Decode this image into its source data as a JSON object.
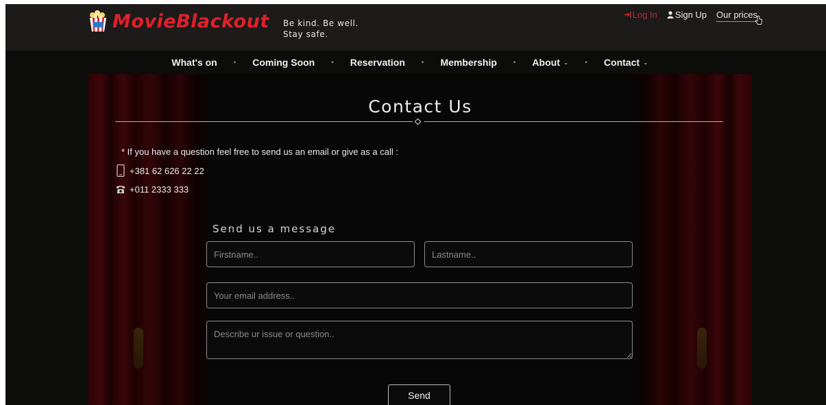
{
  "header": {
    "logo_text": "MovieBlackout",
    "tagline_line1": "Be kind. Be well.",
    "tagline_line2": "Stay safe.",
    "login_label": "Log In",
    "signup_label": "Sign Up",
    "prices_label": "Our prices"
  },
  "nav": {
    "items": [
      {
        "label": "What's on",
        "dropdown": false
      },
      {
        "label": "Coming Soon",
        "dropdown": false
      },
      {
        "label": "Reservation",
        "dropdown": false
      },
      {
        "label": "Membership",
        "dropdown": false
      },
      {
        "label": "About",
        "dropdown": true
      },
      {
        "label": "Contact",
        "dropdown": true
      }
    ]
  },
  "contact": {
    "title": "Contact Us",
    "intro": "* If you have a question feel free to send us an email or give as a call :",
    "mobile": "+381 62 626 22 22",
    "landline": "+011 2333 333",
    "form_heading": "Send us a message",
    "firstname_placeholder": "Firstname..",
    "lastname_placeholder": "Lastname..",
    "email_placeholder": "Your email address..",
    "message_placeholder": "Describe ur issue or question..",
    "send_label": "Send"
  },
  "colors": {
    "brand_red": "#e0202a",
    "login_red": "#c6262a",
    "header_bg": "#1d1a1a",
    "page_bg": "#0c0c0b"
  },
  "icons": {
    "logo": "popcorn-icon",
    "login": "sign-in-icon",
    "signup": "user-icon",
    "mobile": "mobile-phone-icon",
    "landline": "telephone-icon"
  }
}
